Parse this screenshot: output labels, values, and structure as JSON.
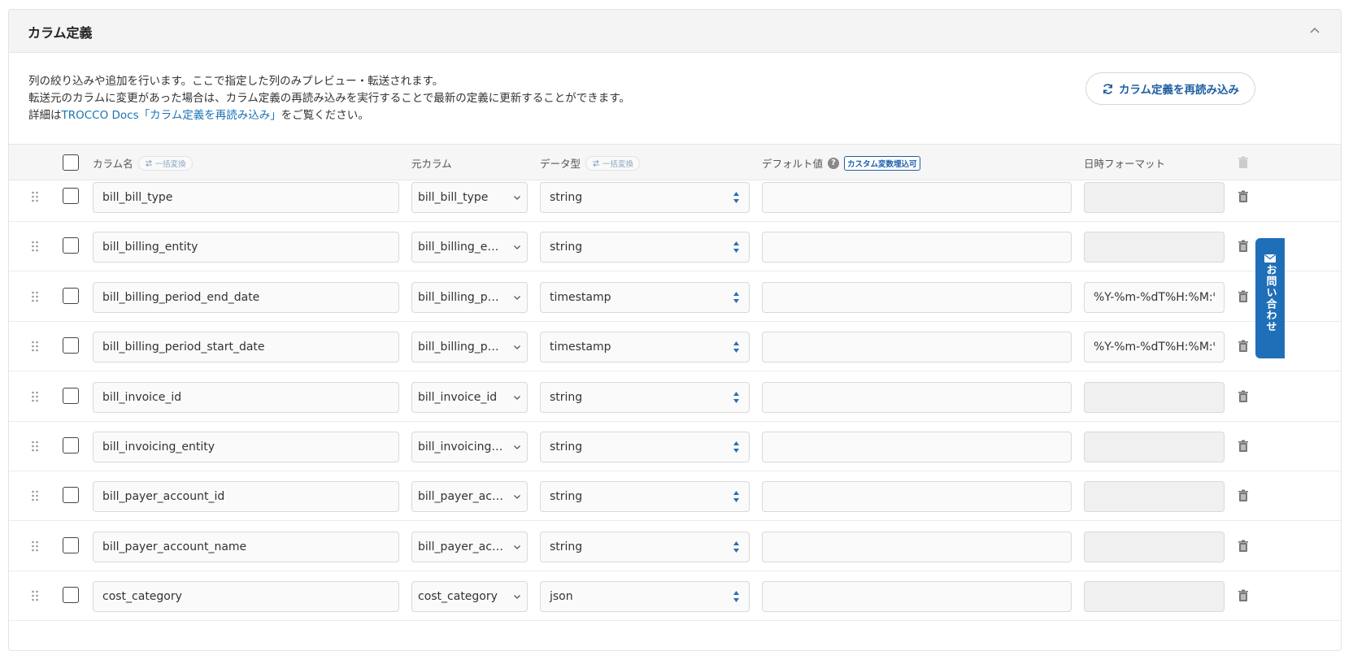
{
  "panel": {
    "title": "カラム定義",
    "description": {
      "line1": "列の絞り込みや追加を行います。ここで指定した列のみプレビュー・転送されます。",
      "line2": "転送元のカラムに変更があった場合は、カラム定義の再読み込みを実行することで最新の定義に更新することができます。",
      "line3_prefix": "詳細は",
      "line3_link": "TROCCO Docs「カラム定義を再読み込み」",
      "line3_suffix": "をご覧ください。"
    },
    "reload_button": "カラム定義を再読み込み"
  },
  "table": {
    "headers": {
      "column_name": "カラム名",
      "bulk_convert": "一括変換",
      "source_column": "元カラム",
      "data_type": "データ型",
      "default_value": "デフォルト値",
      "custom_var_badge": "カスタム変数埋込可",
      "datetime_format": "日時フォーマット"
    },
    "rows": [
      {
        "name": "bill_bill_type",
        "source": "bill_bill_type",
        "type": "string",
        "default": "",
        "format": "",
        "format_enabled": false
      },
      {
        "name": "bill_billing_entity",
        "source": "bill_billing_entity",
        "type": "string",
        "default": "",
        "format": "",
        "format_enabled": false
      },
      {
        "name": "bill_billing_period_end_date",
        "source": "bill_billing_peri...",
        "type": "timestamp",
        "default": "",
        "format": "%Y-%m-%dT%H:%M:%S",
        "format_enabled": true
      },
      {
        "name": "bill_billing_period_start_date",
        "source": "bill_billing_peri...",
        "type": "timestamp",
        "default": "",
        "format": "%Y-%m-%dT%H:%M:%S",
        "format_enabled": true
      },
      {
        "name": "bill_invoice_id",
        "source": "bill_invoice_id",
        "type": "string",
        "default": "",
        "format": "",
        "format_enabled": false
      },
      {
        "name": "bill_invoicing_entity",
        "source": "bill_invoicing_e...",
        "type": "string",
        "default": "",
        "format": "",
        "format_enabled": false
      },
      {
        "name": "bill_payer_account_id",
        "source": "bill_payer_acco...",
        "type": "string",
        "default": "",
        "format": "",
        "format_enabled": false
      },
      {
        "name": "bill_payer_account_name",
        "source": "bill_payer_acco...",
        "type": "string",
        "default": "",
        "format": "",
        "format_enabled": false
      },
      {
        "name": "cost_category",
        "source": "cost_category",
        "type": "json",
        "default": "",
        "format": "",
        "format_enabled": false
      }
    ]
  },
  "contact_tab": {
    "label": "お問い合わせ"
  },
  "colors": {
    "accent": "#1f6fb8",
    "link": "#1a73b8"
  }
}
